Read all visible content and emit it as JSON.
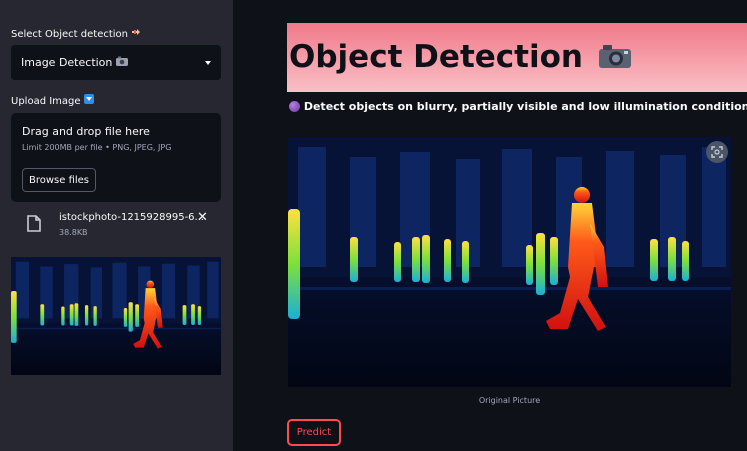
{
  "sidebar": {
    "select_label": "Select Object detection",
    "select_label_icon": "pointing-hand-icon",
    "select_value": "Image Detection",
    "select_value_icon": "camera-icon",
    "upload_label": "Upload Image",
    "upload_label_icon": "down-arrow-icon",
    "dropzone_title": "Drag and drop file here",
    "dropzone_limit": "Limit 200MB per file • PNG, JPEG, JPG",
    "browse_label": "Browse files",
    "file_name": "istockphoto-1215928995-6...",
    "file_size": "38.8KB"
  },
  "main": {
    "title": "Object Detection",
    "title_icon": "camera-icon",
    "subtitle": "Detect objects on blurry, partially visible and low illumination conditions",
    "subtitle_icon": "purple-circle-icon",
    "caption": "Original Picture",
    "predict_label": "Predict"
  },
  "colors": {
    "background": "#0e1117",
    "sidebar": "#262730",
    "accent": "#ff4b4b",
    "banner_top": "#f07989",
    "banner_bottom": "#f9c0c6"
  }
}
